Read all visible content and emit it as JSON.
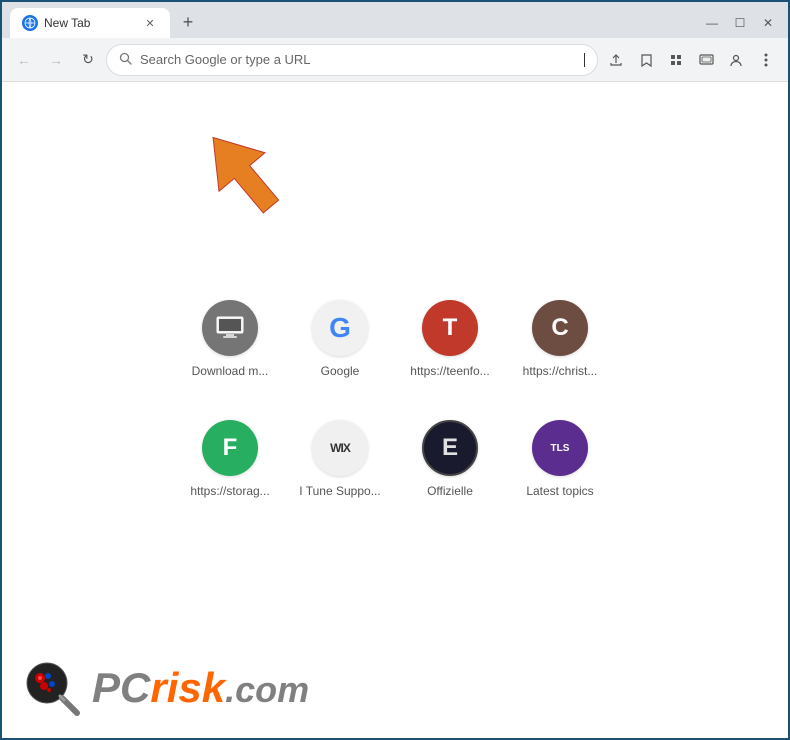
{
  "browser": {
    "tab": {
      "title": "New Tab",
      "favicon": "🌐"
    },
    "new_tab_label": "+",
    "window_controls": {
      "minimize": "—",
      "maximize": "☐",
      "close": "✕"
    },
    "toolbar": {
      "back_label": "←",
      "forward_label": "→",
      "reload_label": "↻",
      "address_placeholder": "Search Google or type a URL",
      "share_label": "⬆",
      "bookmark_label": "☆",
      "extensions_label": "🧩",
      "cast_label": "▭",
      "profile_label": "👤",
      "menu_label": "⋮"
    }
  },
  "shortcuts": [
    {
      "id": "download",
      "label": "Download m...",
      "bg_color": "#555",
      "text_color": "#fff",
      "icon_char": "⬜",
      "icon_emoji": "🖥"
    },
    {
      "id": "google",
      "label": "Google",
      "bg_color": "#f1f1f1",
      "text_color": "#4285f4",
      "icon_char": "G",
      "icon_emoji": null
    },
    {
      "id": "teenfo",
      "label": "https://teenfo...",
      "bg_color": "#c0392b",
      "text_color": "#fff",
      "icon_char": "T",
      "icon_emoji": null
    },
    {
      "id": "christ",
      "label": "https://christ...",
      "bg_color": "#6d4c41",
      "text_color": "#fff",
      "icon_char": "C",
      "icon_emoji": null
    },
    {
      "id": "storag",
      "label": "https://storag...",
      "bg_color": "#27ae60",
      "text_color": "#fff",
      "icon_char": "F",
      "icon_emoji": null
    },
    {
      "id": "wix",
      "label": "I Tune Suppo...",
      "bg_color": "#f0f0f0",
      "text_color": "#333",
      "icon_char": "WIX",
      "icon_emoji": null
    },
    {
      "id": "offizielle",
      "label": "Offizielle",
      "bg_color": "#1a1a2e",
      "text_color": "#fff",
      "icon_char": "E",
      "icon_emoji": null
    },
    {
      "id": "latest-topics",
      "label": "Latest topics",
      "bg_color": "#6a0dad",
      "text_color": "#fff",
      "icon_char": "TLS",
      "icon_emoji": null
    }
  ],
  "logo": {
    "pc_text": "PC",
    "risk_text": "risk",
    "com_text": ".com"
  }
}
